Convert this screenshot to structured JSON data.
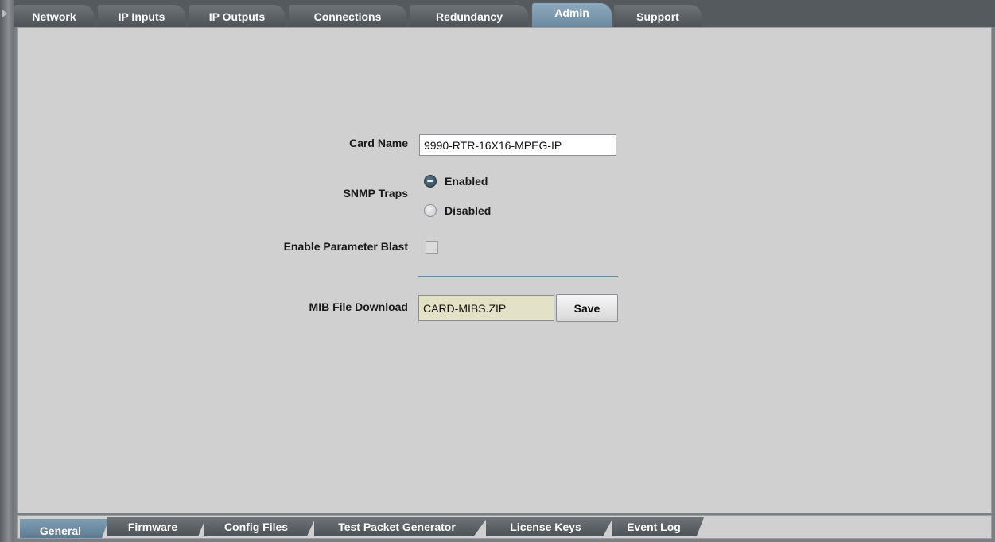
{
  "top_tabs": [
    {
      "label": "Network",
      "active": false
    },
    {
      "label": "IP Inputs",
      "active": false
    },
    {
      "label": "IP Outputs",
      "active": false
    },
    {
      "label": "Connections",
      "active": false
    },
    {
      "label": "Redundancy",
      "active": false
    },
    {
      "label": "Admin",
      "active": true
    },
    {
      "label": "Support",
      "active": false
    }
  ],
  "form": {
    "card_name_label": "Card Name",
    "card_name_value": "9990-RTR-16X16-MPEG-IP",
    "snmp_traps_label": "SNMP Traps",
    "snmp_enabled_label": "Enabled",
    "snmp_disabled_label": "Disabled",
    "snmp_selected": "Enabled",
    "param_blast_label": "Enable Parameter Blast",
    "param_blast_checked": false,
    "mib_label": "MIB File Download",
    "mib_value": "CARD-MIBS.ZIP",
    "save_label": "Save"
  },
  "bottom_tabs": [
    {
      "label": "General",
      "active": true
    },
    {
      "label": "Firmware",
      "active": false
    },
    {
      "label": "Config Files",
      "active": false
    },
    {
      "label": "Test Packet Generator",
      "active": false
    },
    {
      "label": "License Keys",
      "active": false
    },
    {
      "label": "Event Log",
      "active": false
    }
  ],
  "colors": {
    "panel_bg": "#d0d0d0",
    "active_tab": "#7f9db2",
    "inactive_tab": "#5a5f64",
    "mib_field_bg": "#e3e2c6"
  }
}
